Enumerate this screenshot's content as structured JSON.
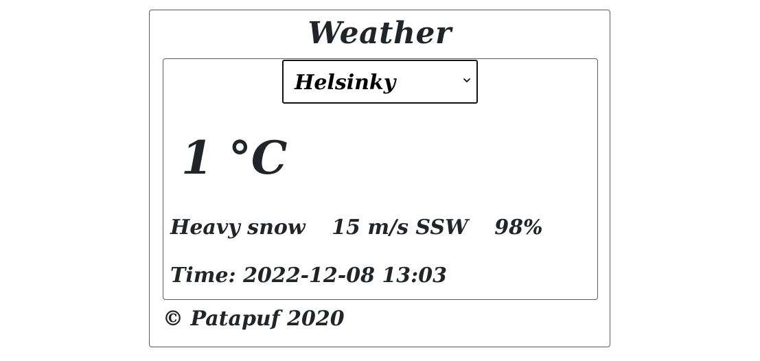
{
  "app": {
    "title": "Weather"
  },
  "city_select": {
    "selected": "Helsinky",
    "icon": "chevron-down-icon"
  },
  "weather": {
    "temperature": "1 °C",
    "condition": "Heavy snow",
    "wind": "15 m/s SSW",
    "humidity": "98%",
    "time_label": "Time:",
    "time_value": "2022-12-08 13:03"
  },
  "footer": {
    "copyright_symbol": "©",
    "author": "Patapuf",
    "year": "2020"
  }
}
